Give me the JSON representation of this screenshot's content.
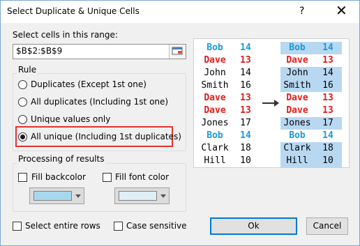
{
  "window": {
    "title": "Select Duplicate & Unique Cells",
    "help": "?",
    "close": "✕"
  },
  "range": {
    "label": "Select cells in this range:",
    "value": "$B$2:$B$9"
  },
  "rule": {
    "title": "Rule",
    "options": [
      {
        "label": "Duplicates (Except 1st one)",
        "selected": false
      },
      {
        "label": "All duplicates (Including 1st one)",
        "selected": false
      },
      {
        "label": "Unique values only",
        "selected": false
      },
      {
        "label": "All unique (Including 1st duplicates)",
        "selected": true
      }
    ]
  },
  "processing": {
    "title": "Processing of results",
    "fill_backcolor": {
      "label": "Fill backcolor",
      "checked": false,
      "color": "#a8d8ee"
    },
    "fill_font_color": {
      "label": "Fill font color",
      "checked": false,
      "color": "#e0eef7"
    }
  },
  "bottom": {
    "select_entire_rows": "Select entire rows",
    "case_sensitive": "Case sensitive",
    "ok": "Ok",
    "cancel": "Cancel"
  },
  "preview": {
    "rows": [
      {
        "name": "Bob",
        "value": "14",
        "color": "#1a9ad6",
        "left_bg": "#ffffff",
        "right_bg": "#b8d8f2"
      },
      {
        "name": "Dave",
        "value": "13",
        "color": "#e31b1b",
        "left_bg": "#ffffff",
        "right_bg": "#ffffff"
      },
      {
        "name": "John",
        "value": "14",
        "color": "#000000",
        "left_bg": "#ffffff",
        "right_bg": "#b8d8f2"
      },
      {
        "name": "Smith",
        "value": "16",
        "color": "#000000",
        "left_bg": "#ffffff",
        "right_bg": "#b8d8f2"
      },
      {
        "name": "Dave",
        "value": "13",
        "color": "#e31b1b",
        "left_bg": "#ffffff",
        "right_bg": "#ffffff"
      },
      {
        "name": "Dave",
        "value": "13",
        "color": "#e31b1b",
        "left_bg": "#ffffff",
        "right_bg": "#ffffff"
      },
      {
        "name": "Jones",
        "value": "17",
        "color": "#000000",
        "left_bg": "#ffffff",
        "right_bg": "#b8d8f2"
      },
      {
        "name": "Bob",
        "value": "14",
        "color": "#1a9ad6",
        "left_bg": "#ffffff",
        "right_bg": "#ffffff"
      },
      {
        "name": "Clark",
        "value": "18",
        "color": "#000000",
        "left_bg": "#ffffff",
        "right_bg": "#b8d8f2"
      },
      {
        "name": "Hill",
        "value": "10",
        "color": "#000000",
        "left_bg": "#ffffff",
        "right_bg": "#b8d8f2"
      }
    ]
  },
  "colors": {
    "accent": "#0078d7",
    "highlight_border": "#e0342e"
  }
}
